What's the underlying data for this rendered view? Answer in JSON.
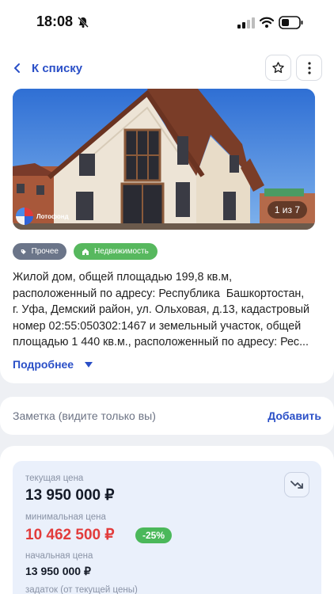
{
  "status_bar": {
    "time": "18:08"
  },
  "header": {
    "back_label": "К списку"
  },
  "photo": {
    "counter": "1 из 7",
    "watermark": "Лотофонд"
  },
  "tags": [
    {
      "label": "Прочее",
      "icon": "tag-icon",
      "color": "#6b7589"
    },
    {
      "label": "Недвижимость",
      "icon": "house-icon",
      "color": "#57b85e"
    }
  ],
  "description": "Жилой дом, общей площадью 199,8 кв.м,\nрасположенный по адресу: Республика  Башкортостан,\nг. Уфа, Демский район, ул. Ольховая, д.13, кадастровый\nномер 02:55:050302:1467 и земельный участок, общей\nплощадью 1 440 кв.м., расположенный по адресу: Рес...",
  "more_label": "Подробнее",
  "note": {
    "label": "Заметка (видите только вы)",
    "action": "Добавить"
  },
  "prices": {
    "current_label": "текущая цена",
    "current_value": "13 950 000 ₽",
    "min_label": "минимальная цена",
    "min_value": "10 462 500 ₽",
    "discount": "-25%",
    "start_label": "начальная цена",
    "start_value": "13 950 000 ₽",
    "deposit_label": "задаток (от текущей цены)"
  },
  "colors": {
    "accent": "#2a4fc7",
    "danger": "#e23b3b",
    "success": "#4bb85a"
  }
}
